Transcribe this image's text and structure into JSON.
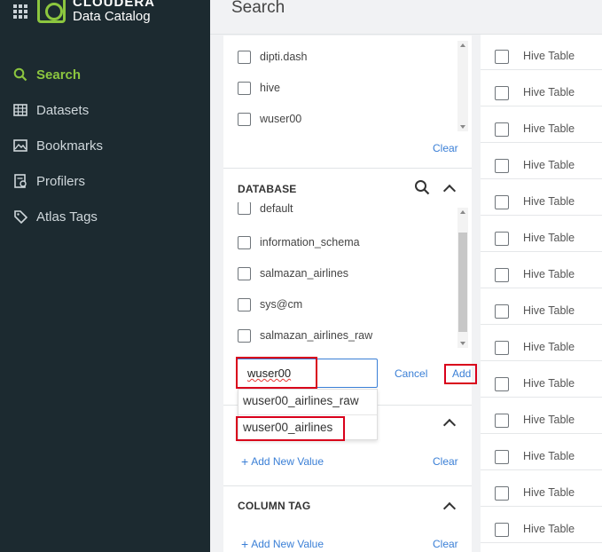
{
  "sidebar": {
    "brand_line1": "CLOUDERA",
    "brand_line2": "Data Catalog",
    "items": [
      {
        "label": "Search",
        "icon": "search-icon"
      },
      {
        "label": "Datasets",
        "icon": "datasets-icon"
      },
      {
        "label": "Bookmarks",
        "icon": "bookmarks-icon"
      },
      {
        "label": "Profilers",
        "icon": "profilers-icon"
      },
      {
        "label": "Atlas Tags",
        "icon": "tag-icon"
      }
    ],
    "accent_color": "#8cc63f"
  },
  "header": {
    "title": "Search"
  },
  "owner_filter": {
    "items": [
      "dipti.dash",
      "hive",
      "wuser00"
    ],
    "clear_label": "Clear"
  },
  "database_filter": {
    "title": "DATABASE",
    "items": [
      "default",
      "information_schema",
      "salmazan_airlines",
      "sys@cm",
      "salmazan_airlines_raw"
    ],
    "input_value": "wuser00",
    "cancel_label": "Cancel",
    "add_label": "Add",
    "suggestions": [
      "wuser00_airlines_raw",
      "wuser00_airlines"
    ]
  },
  "tag_filter": {
    "add_new_label": "Add New Value",
    "clear_label": "Clear"
  },
  "column_tag_filter": {
    "title": "COLUMN TAG",
    "add_new_label": "Add New Value",
    "clear_label": "Clear"
  },
  "results": {
    "items": [
      "Hive Table",
      "Hive Table",
      "Hive Table",
      "Hive Table",
      "Hive Table",
      "Hive Table",
      "Hive Table",
      "Hive Table",
      "Hive Table",
      "Hive Table",
      "Hive Table",
      "Hive Table",
      "Hive Table",
      "Hive Table"
    ]
  }
}
